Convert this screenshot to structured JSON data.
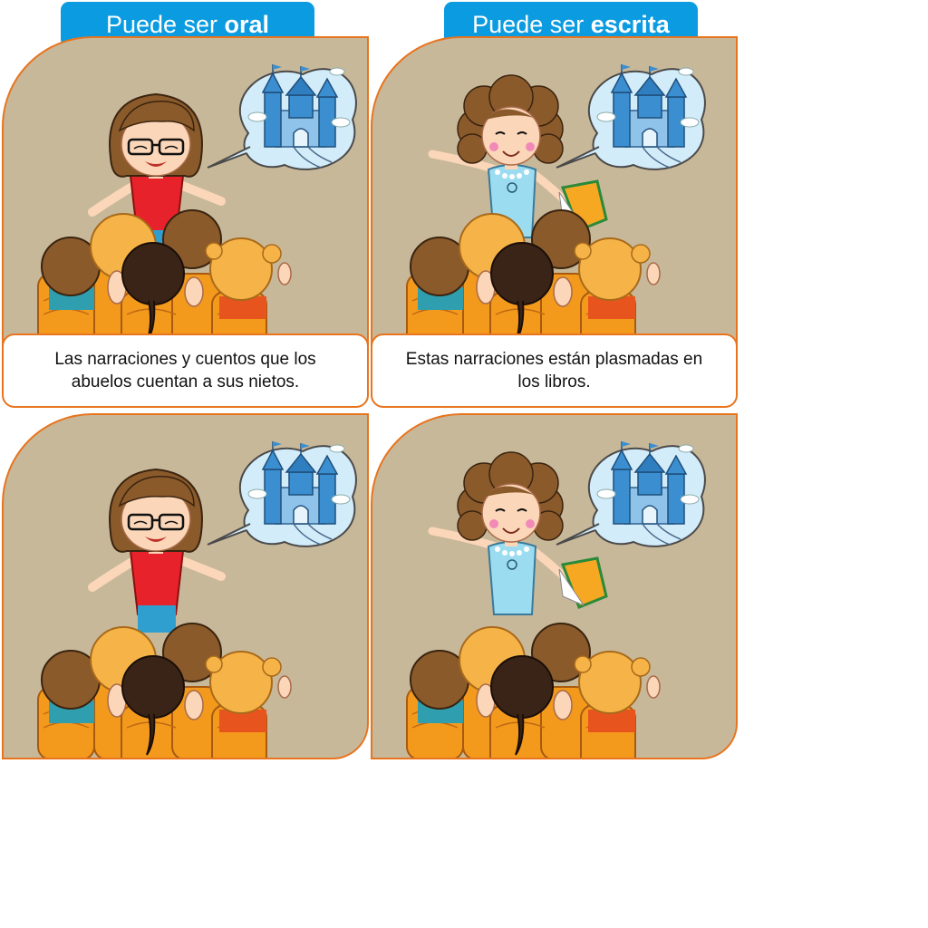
{
  "oral": {
    "header_prefix": "Puede ser",
    "header_emphasis": "oral",
    "caption": "Las narraciones y cuentos que los abuelos cuentan a sus nietos.",
    "teacher_shirt_color": "#e8222a"
  },
  "escrita": {
    "header_prefix": "Puede ser",
    "header_emphasis": "escrita",
    "caption": "Estas narraciones están plasmadas en los libros.",
    "teacher_dress_color": "#9cdcf0",
    "book_color": "#f7a823"
  },
  "colors": {
    "panel_bg": "#c8b89a",
    "border": "#e8741e",
    "header_bg": "#0b9be0",
    "chair": "#f39a1d",
    "castle": "#3b8fd0",
    "bubble": "#d3ecfa"
  }
}
